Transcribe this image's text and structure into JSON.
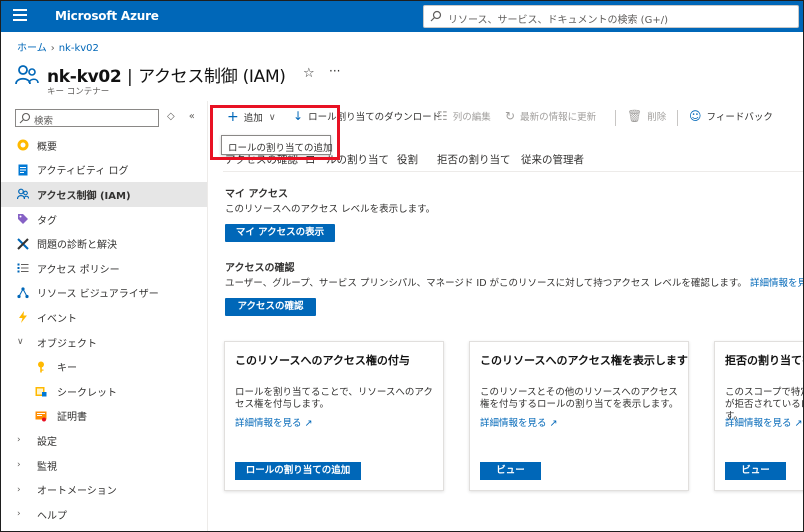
{
  "app": {
    "brand": "Microsoft Azure"
  },
  "search": {
    "placeholder": "リソース、サービス、ドキュメントの検索 (G+/)"
  },
  "breadcrumb": {
    "home": "ホーム",
    "resource": "nk-kv02"
  },
  "header": {
    "resource_name": "nk-kv02",
    "separator": "|",
    "page": "アクセス制御 (IAM)",
    "subtitle": "キー コンテナー",
    "star": "☆",
    "more": "···"
  },
  "sidebar": {
    "search_placeholder": "検索",
    "tool_up": "◇",
    "tool_collapse": "«",
    "items": [
      {
        "label": "概要",
        "icon": "overview-icon"
      },
      {
        "label": "アクティビティ ログ",
        "icon": "activity-log-icon"
      },
      {
        "label": "アクセス制御 (IAM)",
        "icon": "people-icon",
        "active": true
      },
      {
        "label": "タグ",
        "icon": "tag-icon"
      },
      {
        "label": "問題の診断と解決",
        "icon": "wrench-icon"
      },
      {
        "label": "アクセス ポリシー",
        "icon": "list-icon"
      },
      {
        "label": "リソース ビジュアライザー",
        "icon": "visualizer-icon"
      },
      {
        "label": "イベント",
        "icon": "lightning-icon"
      },
      {
        "label": "オブジェクト",
        "expanded": true
      },
      {
        "label": "キー",
        "icon": "key-icon"
      },
      {
        "label": "シークレット",
        "icon": "secret-icon"
      },
      {
        "label": "証明書",
        "icon": "certificate-icon"
      },
      {
        "label": "設定"
      },
      {
        "label": "監視"
      },
      {
        "label": "オートメーション"
      },
      {
        "label": "ヘルプ"
      }
    ]
  },
  "commandbar": {
    "add": "追加",
    "add_chevron": "∨",
    "download": "ロール割り当てのダウンロード",
    "edit_columns": "列の編集",
    "refresh": "最新の情報に更新",
    "delete": "削除",
    "feedback": "フィードバック"
  },
  "tooltip": {
    "text": "ロールの割り当ての追加"
  },
  "tabs": [
    {
      "label": "アクセスの確認"
    },
    {
      "label": "ロールの割り当て"
    },
    {
      "label": "役割"
    },
    {
      "label": "拒否の割り当て"
    },
    {
      "label": "従来の管理者"
    }
  ],
  "my_access": {
    "title": "マイ アクセス",
    "desc": "このリソースへのアクセス レベルを表示します。",
    "button": "マイ アクセスの表示"
  },
  "check_access": {
    "title": "アクセスの確認",
    "desc": "ユーザー、グループ、サービス プリンシパル、マネージド ID がこのリソースに対して持つアクセス レベルを確認します。",
    "link": "詳細情報を見る",
    "button": "アクセスの確認"
  },
  "cards": [
    {
      "title": "このリソースへのアクセス権の付与",
      "desc": "ロールを割り当てることで、リソースへのアクセス権を付与します。",
      "link": "詳細情報を見る",
      "button": "ロールの割り当ての追加"
    },
    {
      "title": "このリソースへのアクセス権を表示します",
      "desc": "このリソースとその他のリソースへのアクセス権を付与するロールの割り当てを表示します。",
      "link": "詳細情報を見る",
      "button": "ビュー"
    },
    {
      "title": "拒否の割り当てを",
      "desc": "このスコープで特定のアクションへのアクセスが拒否されているロールの割り当てを表示します。",
      "link": "詳細情報を見る",
      "button": "ビュー"
    }
  ],
  "colors": {
    "azure_blue": "#0067b8",
    "highlight_red": "#e81123"
  }
}
